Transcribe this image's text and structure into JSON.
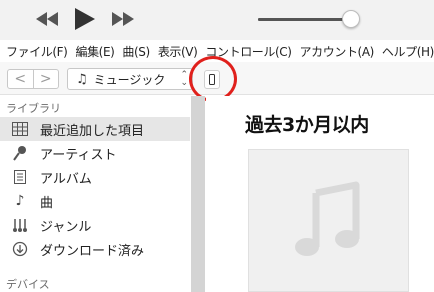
{
  "player": {
    "rewind_icon": "rewind-icon",
    "play_icon": "play-icon",
    "forward_icon": "fast-forward-icon",
    "volume_level": 0.97
  },
  "menubar": {
    "items": [
      "ファイル(F)",
      "編集(E)",
      "曲(S)",
      "表示(V)",
      "コントロール(C)",
      "アカウント(A)",
      "ヘルプ(H)"
    ]
  },
  "toolbar": {
    "back_label": "<",
    "forward_label": ">",
    "media_kind": "ミュージック",
    "device_icon": "iphone-icon"
  },
  "sidebar": {
    "library_header": "ライブラリ",
    "items": [
      {
        "label": "最近追加した項目",
        "icon": "grid-icon",
        "selected": true
      },
      {
        "label": "アーティスト",
        "icon": "microphone-icon",
        "selected": false
      },
      {
        "label": "アルバム",
        "icon": "album-icon",
        "selected": false
      },
      {
        "label": "曲",
        "icon": "music-note-icon",
        "selected": false
      },
      {
        "label": "ジャンル",
        "icon": "genre-icon",
        "selected": false
      },
      {
        "label": "ダウンロード済み",
        "icon": "download-icon",
        "selected": false
      }
    ],
    "devices_header": "デバイス"
  },
  "main": {
    "title": "過去3か月以内"
  },
  "colors": {
    "annotation": "#e0201c",
    "selected_row": "#e6e6e6"
  }
}
